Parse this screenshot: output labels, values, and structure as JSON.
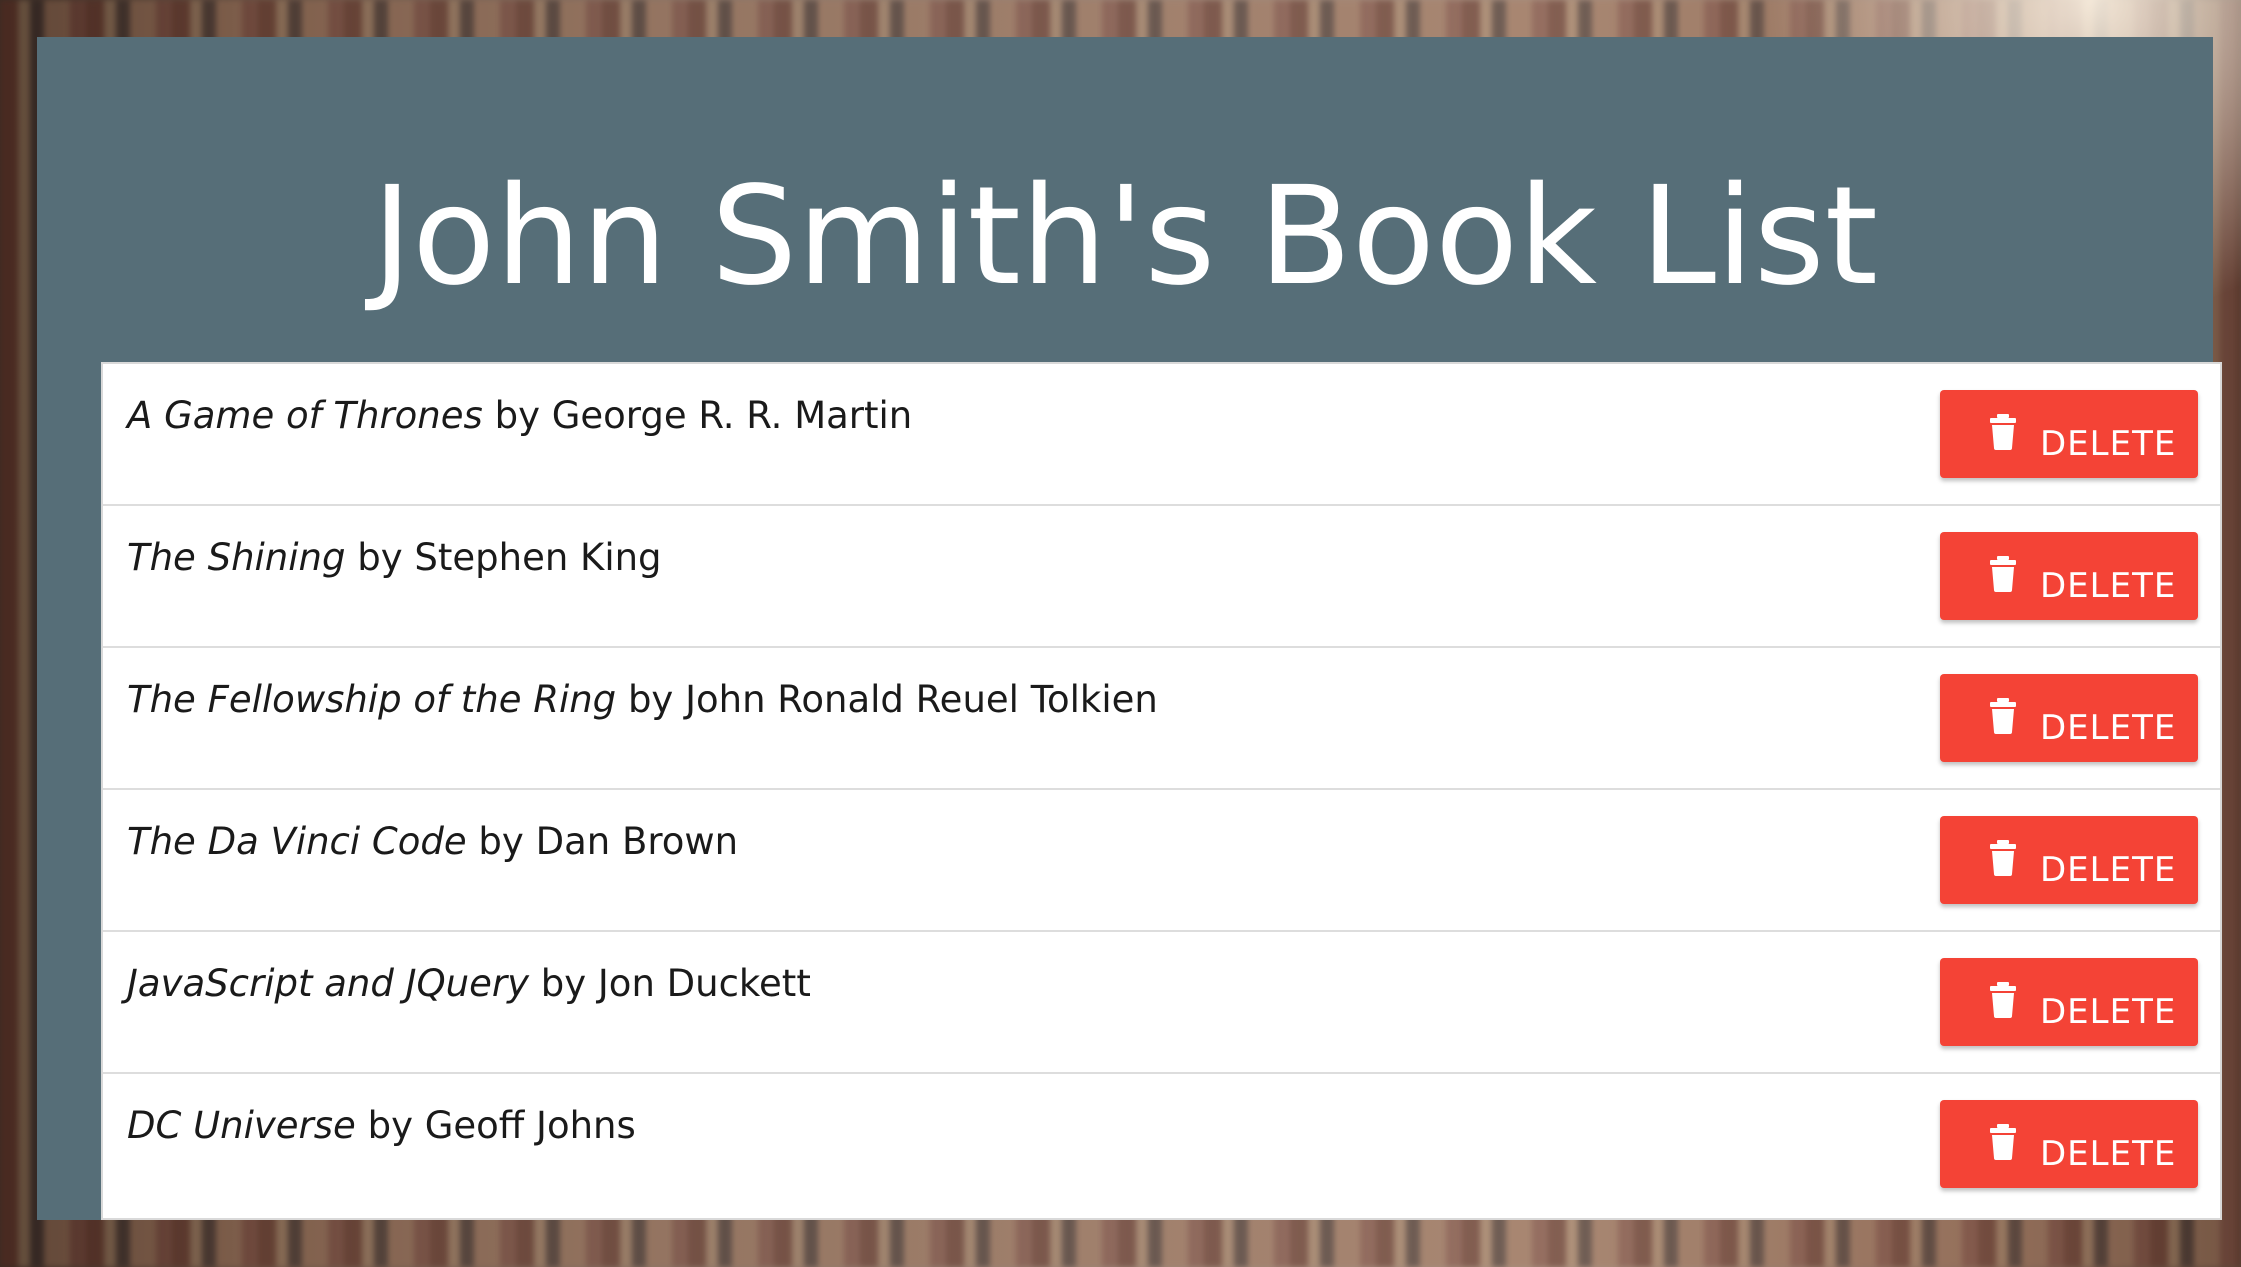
{
  "page": {
    "title": "John Smith's Book List"
  },
  "books": [
    {
      "title": "A Game of Thrones",
      "by": "by",
      "author": "George R. R. Martin",
      "delete_label": "DELETE"
    },
    {
      "title": "The Shining",
      "by": "by",
      "author": "Stephen King",
      "delete_label": "DELETE"
    },
    {
      "title": "The Fellowship of the Ring",
      "by": "by",
      "author": "John Ronald Reuel Tolkien",
      "delete_label": "DELETE"
    },
    {
      "title": "The Da Vinci Code",
      "by": "by",
      "author": "Dan Brown",
      "delete_label": "DELETE"
    },
    {
      "title": "JavaScript and JQuery",
      "by": "by",
      "author": "Jon Duckett",
      "delete_label": "DELETE"
    },
    {
      "title": "DC Universe",
      "by": "by",
      "author": "Geoff Johns",
      "delete_label": "DELETE"
    }
  ],
  "icons": {
    "delete": "trash-icon"
  },
  "colors": {
    "panel": "#566e78",
    "delete_button": "#f44336",
    "list_background": "#ffffff"
  }
}
